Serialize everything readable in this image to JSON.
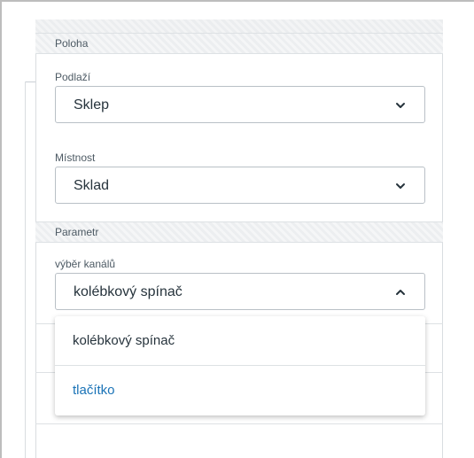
{
  "sections": {
    "location": {
      "header": "Poloha",
      "floor": {
        "label": "Podlaží",
        "value": "Sklep"
      },
      "room": {
        "label": "Místnost",
        "value": "Sklad"
      }
    },
    "parameter": {
      "header": "Parametr",
      "channel": {
        "label": "výběr kanálů",
        "value": "kolébkový spínač",
        "expanded": true,
        "options": [
          "kolébkový spínač",
          "tlačítko"
        ]
      }
    }
  },
  "colors": {
    "accent_link": "#1a73b7",
    "text": "#26333c",
    "border": "#b9c0c6"
  },
  "icons": {
    "collapsed": "chevron-down-icon",
    "expanded": "chevron-up-icon"
  }
}
